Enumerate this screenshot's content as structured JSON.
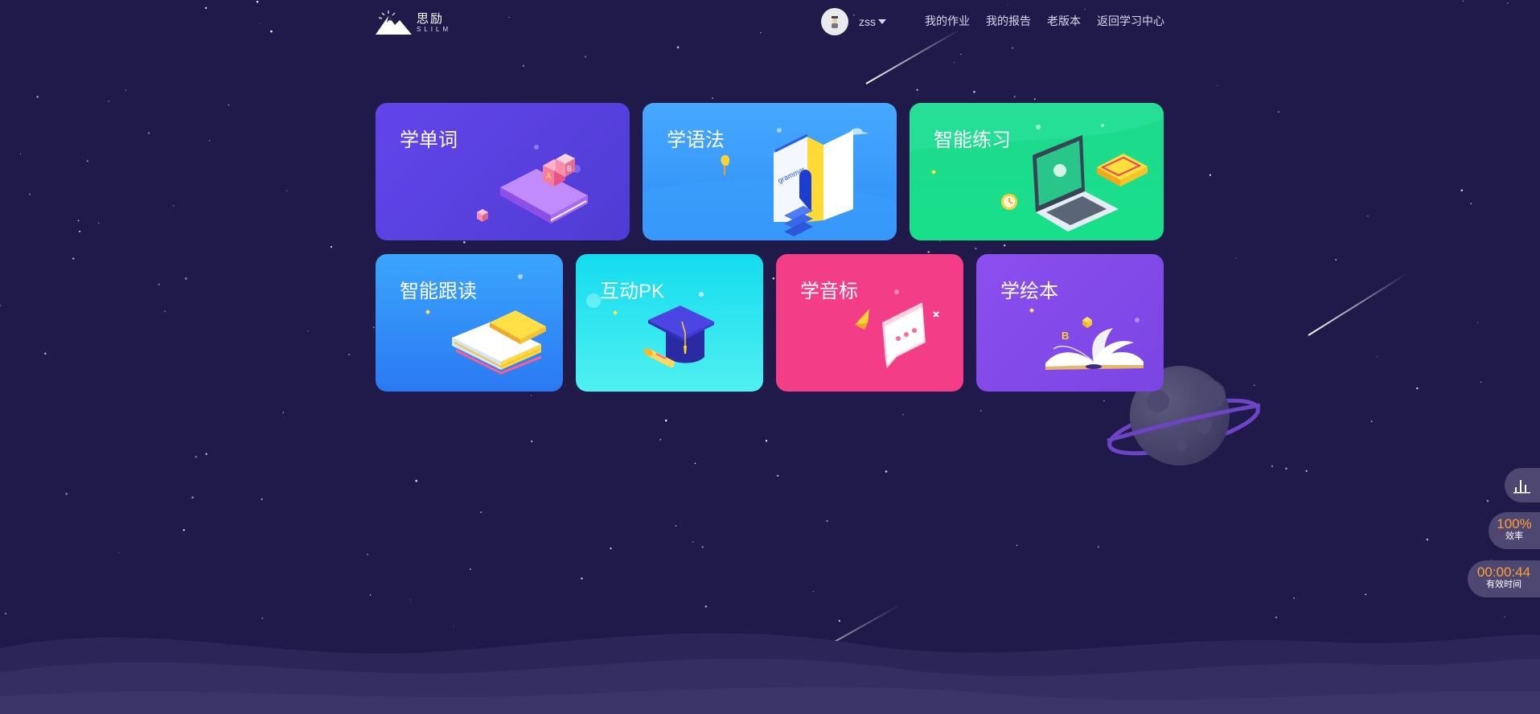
{
  "header": {
    "logo": {
      "cn": "思励",
      "en": "SLILM"
    },
    "user": {
      "name": "zss"
    },
    "nav": [
      "我的作业",
      "我的报告",
      "老版本",
      "返回学习中心"
    ]
  },
  "cards": [
    {
      "title": "学单词",
      "icon": "word-cubes-book-icon"
    },
    {
      "title": "学语法",
      "icon": "grammar-book-door-icon"
    },
    {
      "title": "智能练习",
      "icon": "laptop-practice-icon"
    },
    {
      "title": "智能跟读",
      "icon": "open-book-icon"
    },
    {
      "title": "互动PK",
      "icon": "graduation-cap-icon"
    },
    {
      "title": "学音标",
      "icon": "speech-bubble-icon"
    },
    {
      "title": "学绘本",
      "icon": "picture-book-icon"
    }
  ],
  "float_panel": {
    "stats_icon": "bar-chart-icon",
    "efficiency": {
      "value": "100%",
      "label": "效率"
    },
    "effective_time": {
      "value": "00:00:44",
      "label": "有效时间"
    },
    "value_color": "#ffa033"
  },
  "colors": {
    "background": "#201a4a",
    "card_word": "#6245ea",
    "card_grammar": "#46a9fe",
    "card_practice": "#1ed98d",
    "card_read": "#3aa5fd",
    "card_pk": "#14dcee",
    "card_phonetic": "#f33d87",
    "card_picturebook": "#8b4fee"
  }
}
